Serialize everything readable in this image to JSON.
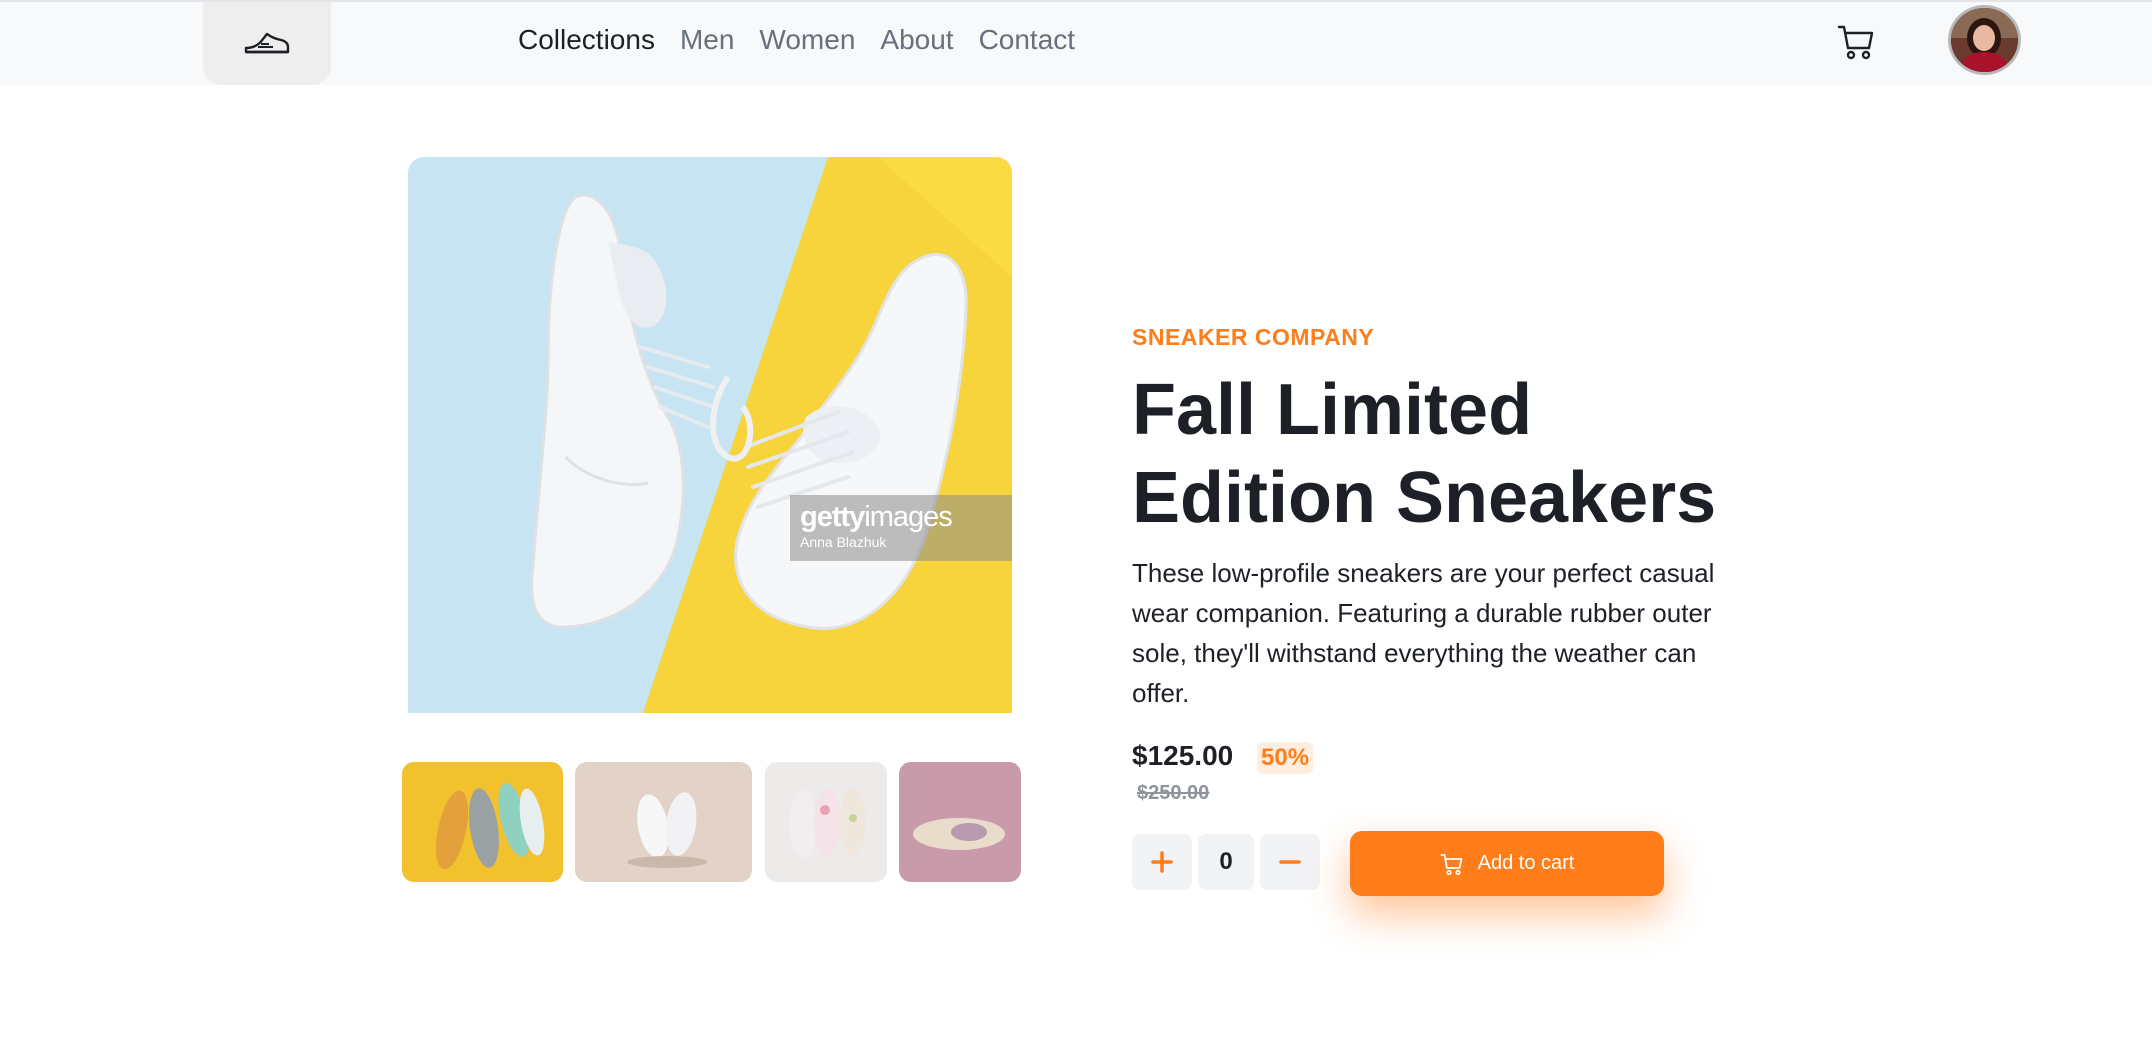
{
  "nav": {
    "items": [
      {
        "label": "Collections",
        "active": true
      },
      {
        "label": "Men",
        "active": false
      },
      {
        "label": "Women",
        "active": false
      },
      {
        "label": "About",
        "active": false
      },
      {
        "label": "Contact",
        "active": false
      }
    ]
  },
  "icons": {
    "logo": "sneaker-icon",
    "cart": "cart-icon",
    "avatar": "user-avatar"
  },
  "gallery": {
    "watermark_brand_prefix": "getty",
    "watermark_brand_suffix": "images",
    "watermark_credit": "Anna Blazhuk",
    "thumbnails": [
      "orange-grey-sneakers",
      "white-sneakers-beige",
      "floral-sneakers",
      "sneaker-sole-pink"
    ]
  },
  "product": {
    "company": "SNEAKER COMPANY",
    "title": "Fall Limited Edition Sneakers",
    "description": "These low-profile sneakers are your perfect casual wear companion. Featuring a durable rubber outer sole, they'll withstand everything the weather can offer.",
    "price": "$125.00",
    "discount": "50%",
    "original_price": "$250.00",
    "quantity": "0",
    "add_to_cart_label": "Add to cart"
  },
  "colors": {
    "accent": "#ff7d1a",
    "accent_pale": "#ffede0",
    "text_dark": "#1d2026",
    "text_grey": "#68707d"
  }
}
